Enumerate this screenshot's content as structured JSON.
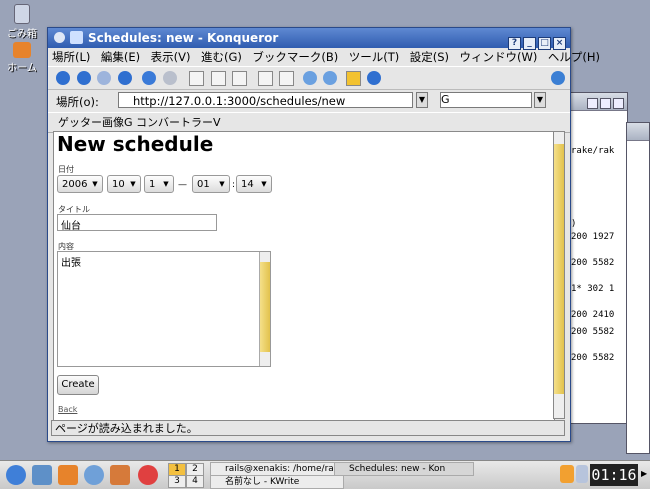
{
  "desktop": {
    "icons": [
      {
        "label": "ごみ箱",
        "icon": "trash-icon"
      },
      {
        "label": "ホーム",
        "icon": "home-icon"
      }
    ]
  },
  "back_windows": {
    "terminal_lines": [
      "rake/rak",
      ")",
      "200 1927",
      "200 5582",
      "1* 302 1",
      "200 2410",
      "200 5582",
      "200 5582"
    ]
  },
  "window": {
    "title": "Schedules: new - Konqueror",
    "controls": [
      "?",
      "_",
      "□",
      "×"
    ]
  },
  "menu": [
    "場所(L)",
    "編集(E)",
    "表示(V)",
    "進む(G)",
    "ブックマーク(B)",
    "ツール(T)",
    "設定(S)",
    "ウィンドウ(W)",
    "ヘルプ(H)"
  ],
  "location": {
    "label": "場所(o):",
    "url": "http://127.0.0.1:3000/schedules/new",
    "search_value": "G"
  },
  "bookmarks": {
    "item": "ゲッター画像G コンバートラーV"
  },
  "page": {
    "heading": "New schedule",
    "date_label": "日付",
    "date": {
      "year": "2006",
      "month": "10",
      "day": "1",
      "hour": "01",
      "minute": "14"
    },
    "date_sep1": "—",
    "date_sep2": ":",
    "title_label": "タイトル",
    "title_value": "仙台",
    "content_label": "内容",
    "content_value": "出張",
    "create_button": "Create",
    "back_link": "Back"
  },
  "status": "ページが読み込まれました。",
  "taskbar": {
    "pager": [
      "1",
      "2",
      "3",
      "4"
    ],
    "tasks": [
      {
        "label": "rails@xenakis: /home/ra"
      },
      {
        "label": "Schedules: new - Kon"
      },
      {
        "label": "名前なし - KWrite"
      }
    ],
    "clock": "01:16"
  },
  "colors": {
    "titlebar": "#3b67bd",
    "scroll_thumb": "#e8ca56",
    "desktop": "#9aa3b8"
  }
}
